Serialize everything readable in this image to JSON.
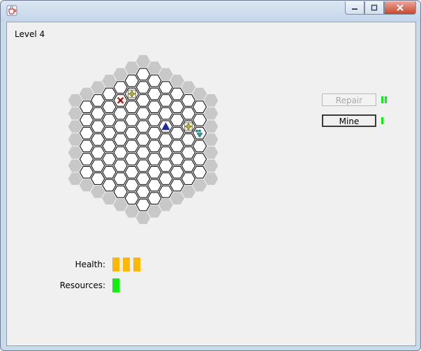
{
  "window": {
    "title": "",
    "icon": "java-cup-icon",
    "controls": [
      "minimize-icon",
      "maximize-icon",
      "close-icon"
    ]
  },
  "game": {
    "level_label": "Level 4",
    "buttons": {
      "repair": {
        "label": "Repair",
        "enabled": false,
        "cost_units": 2
      },
      "mine": {
        "label": "Mine",
        "enabled": true,
        "cost_units": 1
      }
    },
    "stats": {
      "health_label": "Health:",
      "health_units": 3,
      "resources_label": "Resources:",
      "resources_units": 1
    },
    "board": {
      "shape": "hexagon-of-hexagons",
      "radius": 6,
      "ring_color": "#c8c8c8",
      "cell_fill": "#ffffff",
      "cell_stroke": "#000000",
      "pieces": [
        {
          "type": "star-marker",
          "icon": "sparkle-icon",
          "q": -1,
          "r": -3
        },
        {
          "type": "enemy",
          "icon": "red-x-icon",
          "q": -2,
          "r": -2
        },
        {
          "type": "player",
          "icon": "blue-triangle-icon",
          "q": 2,
          "r": -2
        },
        {
          "type": "star-marker",
          "icon": "sparkle-icon",
          "q": 4,
          "r": -3
        },
        {
          "type": "resource",
          "icon": "teal-dots-icon",
          "q": 5,
          "r": -3
        }
      ]
    },
    "colors": {
      "health": "#ffb800",
      "resources": "#11ee11"
    }
  }
}
